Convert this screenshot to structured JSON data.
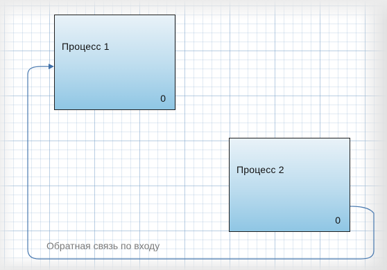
{
  "diagram": {
    "processes": [
      {
        "title": "Процесс 1",
        "count": "0"
      },
      {
        "title": "Процесс 2",
        "count": "0"
      }
    ],
    "feedback_label": "Обратная связь по входу",
    "colors": {
      "box_top": "#e9f2f8",
      "box_bottom": "#8fc6e4",
      "connector": "#4a7ab0"
    }
  }
}
